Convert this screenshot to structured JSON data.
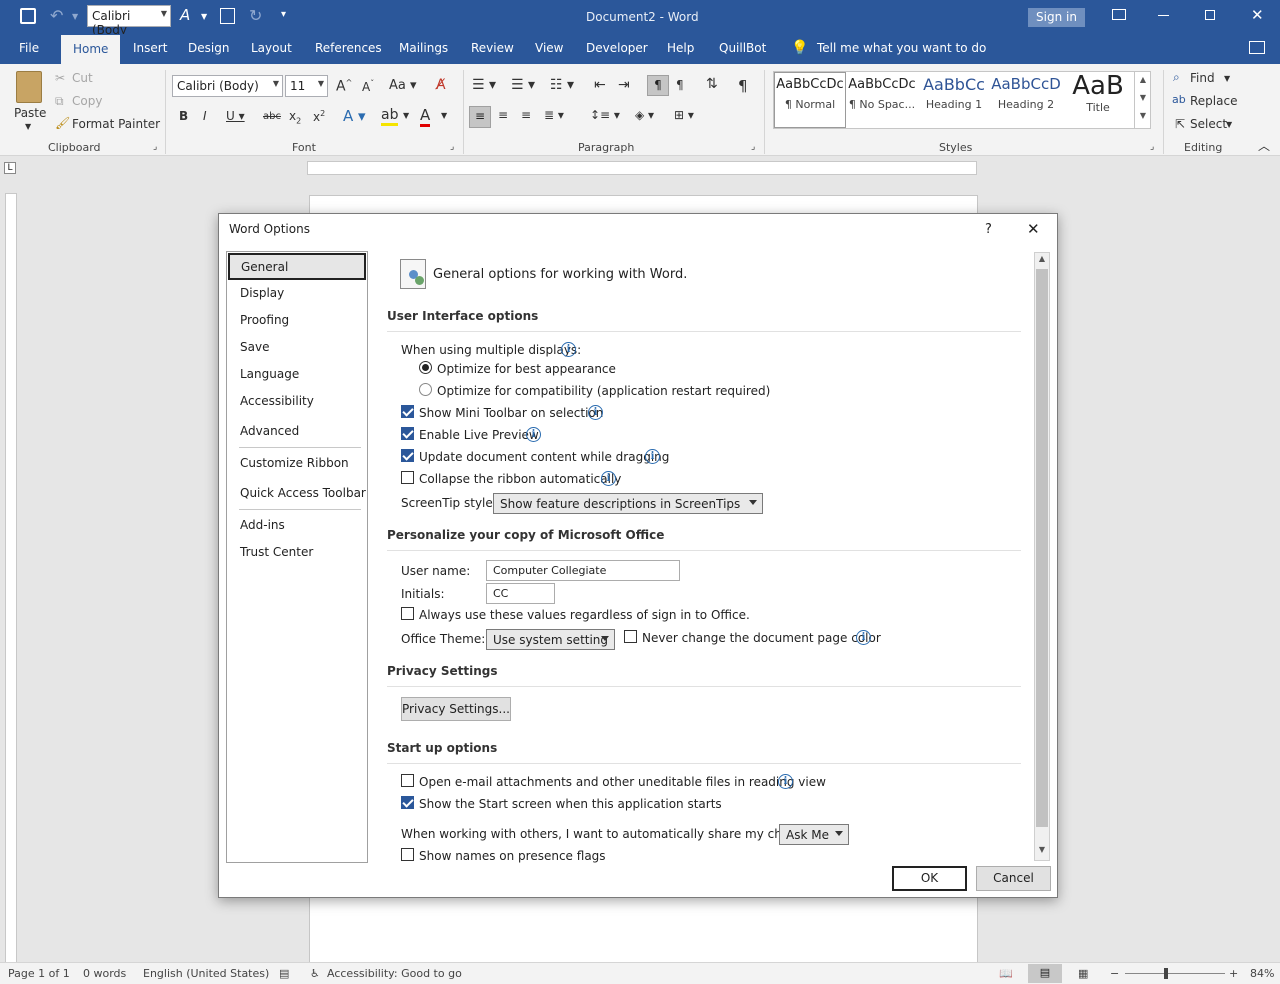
{
  "window": {
    "title": "Document2  -  Word",
    "sign_in": "Sign in"
  },
  "qat": {
    "font_box": "Calibri (Body"
  },
  "tabs": [
    "File",
    "Home",
    "Insert",
    "Design",
    "Layout",
    "References",
    "Mailings",
    "Review",
    "View",
    "Developer",
    "Help",
    "QuillBot"
  ],
  "tell_me": "Tell me what you want to do",
  "ribbon": {
    "clipboard": {
      "paste": "Paste",
      "cut": "Cut",
      "copy": "Copy",
      "format_painter": "Format Painter",
      "label": "Clipboard"
    },
    "font": {
      "name": "Calibri (Body)",
      "size": "11",
      "label": "Font"
    },
    "paragraph": {
      "label": "Paragraph"
    },
    "styles": {
      "label": "Styles",
      "items": [
        {
          "preview": "AaBbCcDc",
          "name": "¶ Normal"
        },
        {
          "preview": "AaBbCcDc",
          "name": "¶ No Spac..."
        },
        {
          "preview": "AaBbCc",
          "name": "Heading 1"
        },
        {
          "preview": "AaBbCcD",
          "name": "Heading 2"
        },
        {
          "preview": "AaB",
          "name": "Title"
        }
      ]
    },
    "editing": {
      "find": "Find",
      "replace": "Replace",
      "select": "Select",
      "label": "Editing"
    }
  },
  "status": {
    "page": "Page 1 of 1",
    "words": "0 words",
    "language": "English (United States)",
    "accessibility": "Accessibility: Good to go",
    "zoom": "84%"
  },
  "dialog": {
    "title": "Word Options",
    "help": "?",
    "close": "✕",
    "nav": [
      "General",
      "Display",
      "Proofing",
      "Save",
      "Language",
      "Accessibility",
      "Advanced",
      "Customize Ribbon",
      "Quick Access Toolbar",
      "Add-ins",
      "Trust Center"
    ],
    "header": "General options for working with Word.",
    "ui_section": {
      "title": "User Interface options",
      "multi_displays": "When using multiple displays:",
      "opt_best": "Optimize for best appearance",
      "opt_compat": "Optimize for compatibility (application restart required)",
      "mini_toolbar": "Show Mini Toolbar on selection",
      "live_preview": "Enable Live Preview",
      "update_content": "Update document content while dragging",
      "collapse_ribbon": "Collapse the ribbon automatically",
      "screentip_label": "ScreenTip style:",
      "screentip_value": "Show feature descriptions in ScreenTips"
    },
    "personalize": {
      "title": "Personalize your copy of Microsoft Office",
      "user_name_label": "User name:",
      "user_name": "Computer Collegiate",
      "initials_label": "Initials:",
      "initials": "CC",
      "always_use": "Always use these values regardless of sign in to Office.",
      "theme_label": "Office Theme:",
      "theme_value": "Use system setting",
      "never_change": "Never change the document page color"
    },
    "privacy": {
      "title": "Privacy Settings",
      "button": "Privacy Settings..."
    },
    "startup": {
      "title": "Start up options",
      "open_email": "Open e-mail attachments and other uneditable files in reading view",
      "show_start": "Show the Start screen when this application starts",
      "share_label": "When working with others, I want to automatically share my changes:",
      "share_value": "Ask Me",
      "presence": "Show names on presence flags"
    },
    "ok": "OK",
    "cancel": "Cancel"
  }
}
